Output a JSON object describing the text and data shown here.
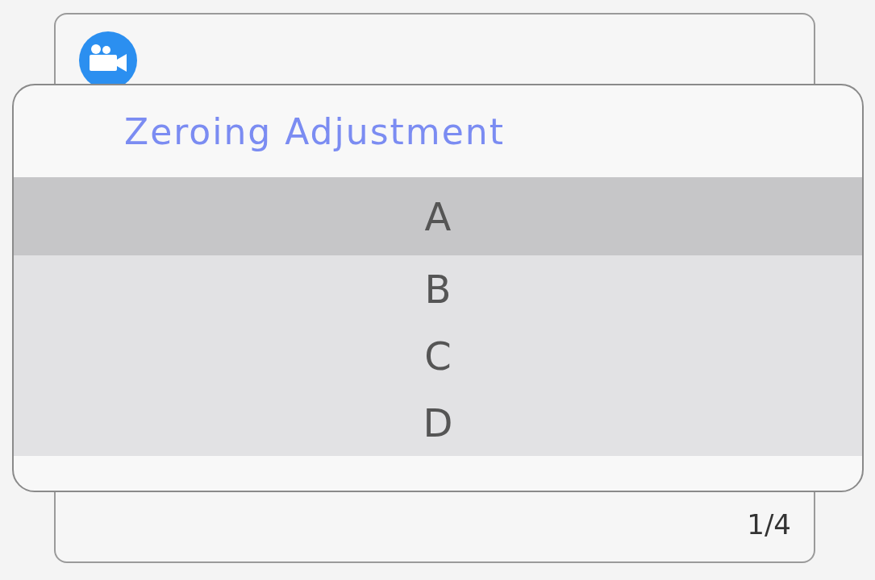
{
  "dialog": {
    "title": "Zeroing Adjustment",
    "options": [
      {
        "label": "A",
        "selected": true
      },
      {
        "label": "B",
        "selected": false
      },
      {
        "label": "C",
        "selected": false
      },
      {
        "label": "D",
        "selected": false
      }
    ]
  },
  "page_indicator": "1/4"
}
